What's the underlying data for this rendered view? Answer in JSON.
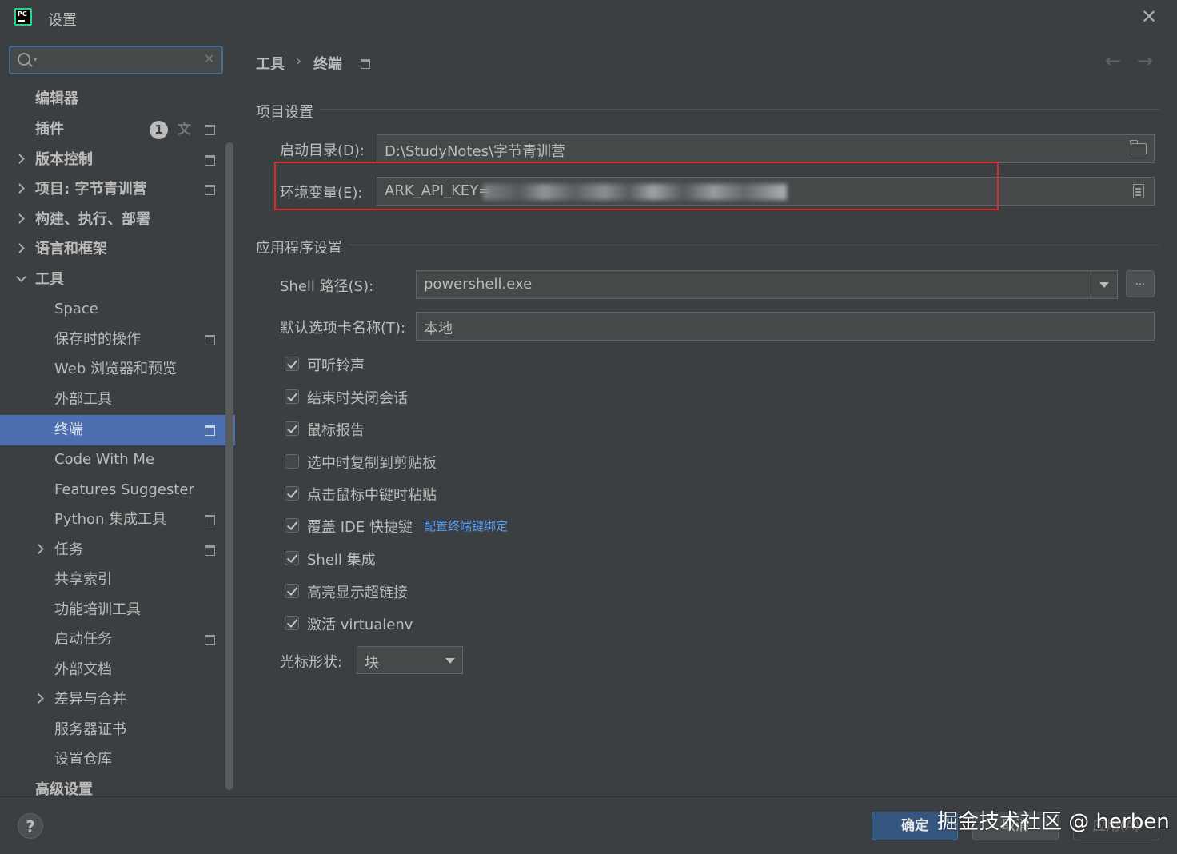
{
  "window": {
    "title": "设置",
    "logo_text": "PC"
  },
  "search": {
    "value": "",
    "placeholder": ""
  },
  "sidebar": {
    "plugins_badge": "1",
    "items": [
      {
        "label": "编辑器"
      },
      {
        "label": "插件"
      },
      {
        "label": "版本控制"
      },
      {
        "label": "项目: 字节青训营"
      },
      {
        "label": "构建、执行、部署"
      },
      {
        "label": "语言和框架"
      },
      {
        "label": "工具"
      },
      {
        "label": "Space"
      },
      {
        "label": "保存时的操作"
      },
      {
        "label": "Web 浏览器和预览"
      },
      {
        "label": "外部工具"
      },
      {
        "label": "终端"
      },
      {
        "label": "Code With Me"
      },
      {
        "label": "Features Suggester"
      },
      {
        "label": "Python 集成工具"
      },
      {
        "label": "任务"
      },
      {
        "label": "共享索引"
      },
      {
        "label": "功能培训工具"
      },
      {
        "label": "启动任务"
      },
      {
        "label": "外部文档"
      },
      {
        "label": "差异与合并"
      },
      {
        "label": "服务器证书"
      },
      {
        "label": "设置仓库"
      },
      {
        "label": "高级设置"
      }
    ]
  },
  "breadcrumb": {
    "parent": "工具",
    "separator": "›",
    "current": "终端"
  },
  "project_settings": {
    "title": "项目设置",
    "start_dir_label": "启动目录(D):",
    "start_dir_value": "D:\\StudyNotes\\字节青训营",
    "env_label": "环境变量(E):",
    "env_value": "ARK_API_KEY="
  },
  "app_settings": {
    "title": "应用程序设置",
    "shell_label": "Shell 路径(S):",
    "shell_value": "powershell.exe",
    "browse_label": "...",
    "tab_name_label": "默认选项卡名称(T):",
    "tab_name_value": "本地",
    "checkboxes": [
      {
        "label": "可听铃声",
        "checked": true
      },
      {
        "label": "结束时关闭会话",
        "checked": true
      },
      {
        "label": "鼠标报告",
        "checked": true
      },
      {
        "label": "选中时复制到剪贴板",
        "checked": false
      },
      {
        "label": "点击鼠标中键时粘贴",
        "checked": true
      },
      {
        "label": "覆盖 IDE 快捷键",
        "checked": true,
        "link": "配置终端键绑定"
      },
      {
        "label": "Shell 集成",
        "checked": true
      },
      {
        "label": "高亮显示超链接",
        "checked": true
      },
      {
        "label": "激活 virtualenv",
        "checked": true
      }
    ],
    "cursor_label": "光标形状:",
    "cursor_value": "块"
  },
  "buttons": {
    "ok": "确定",
    "cancel": "取消",
    "apply": "应用(A)",
    "help": "?"
  },
  "watermark": "掘金技术社区 @ herben",
  "colors": {
    "selection": "#4b6eaf",
    "highlight_box": "#e0282d",
    "link": "#589df6",
    "ok_button": "#365880"
  }
}
